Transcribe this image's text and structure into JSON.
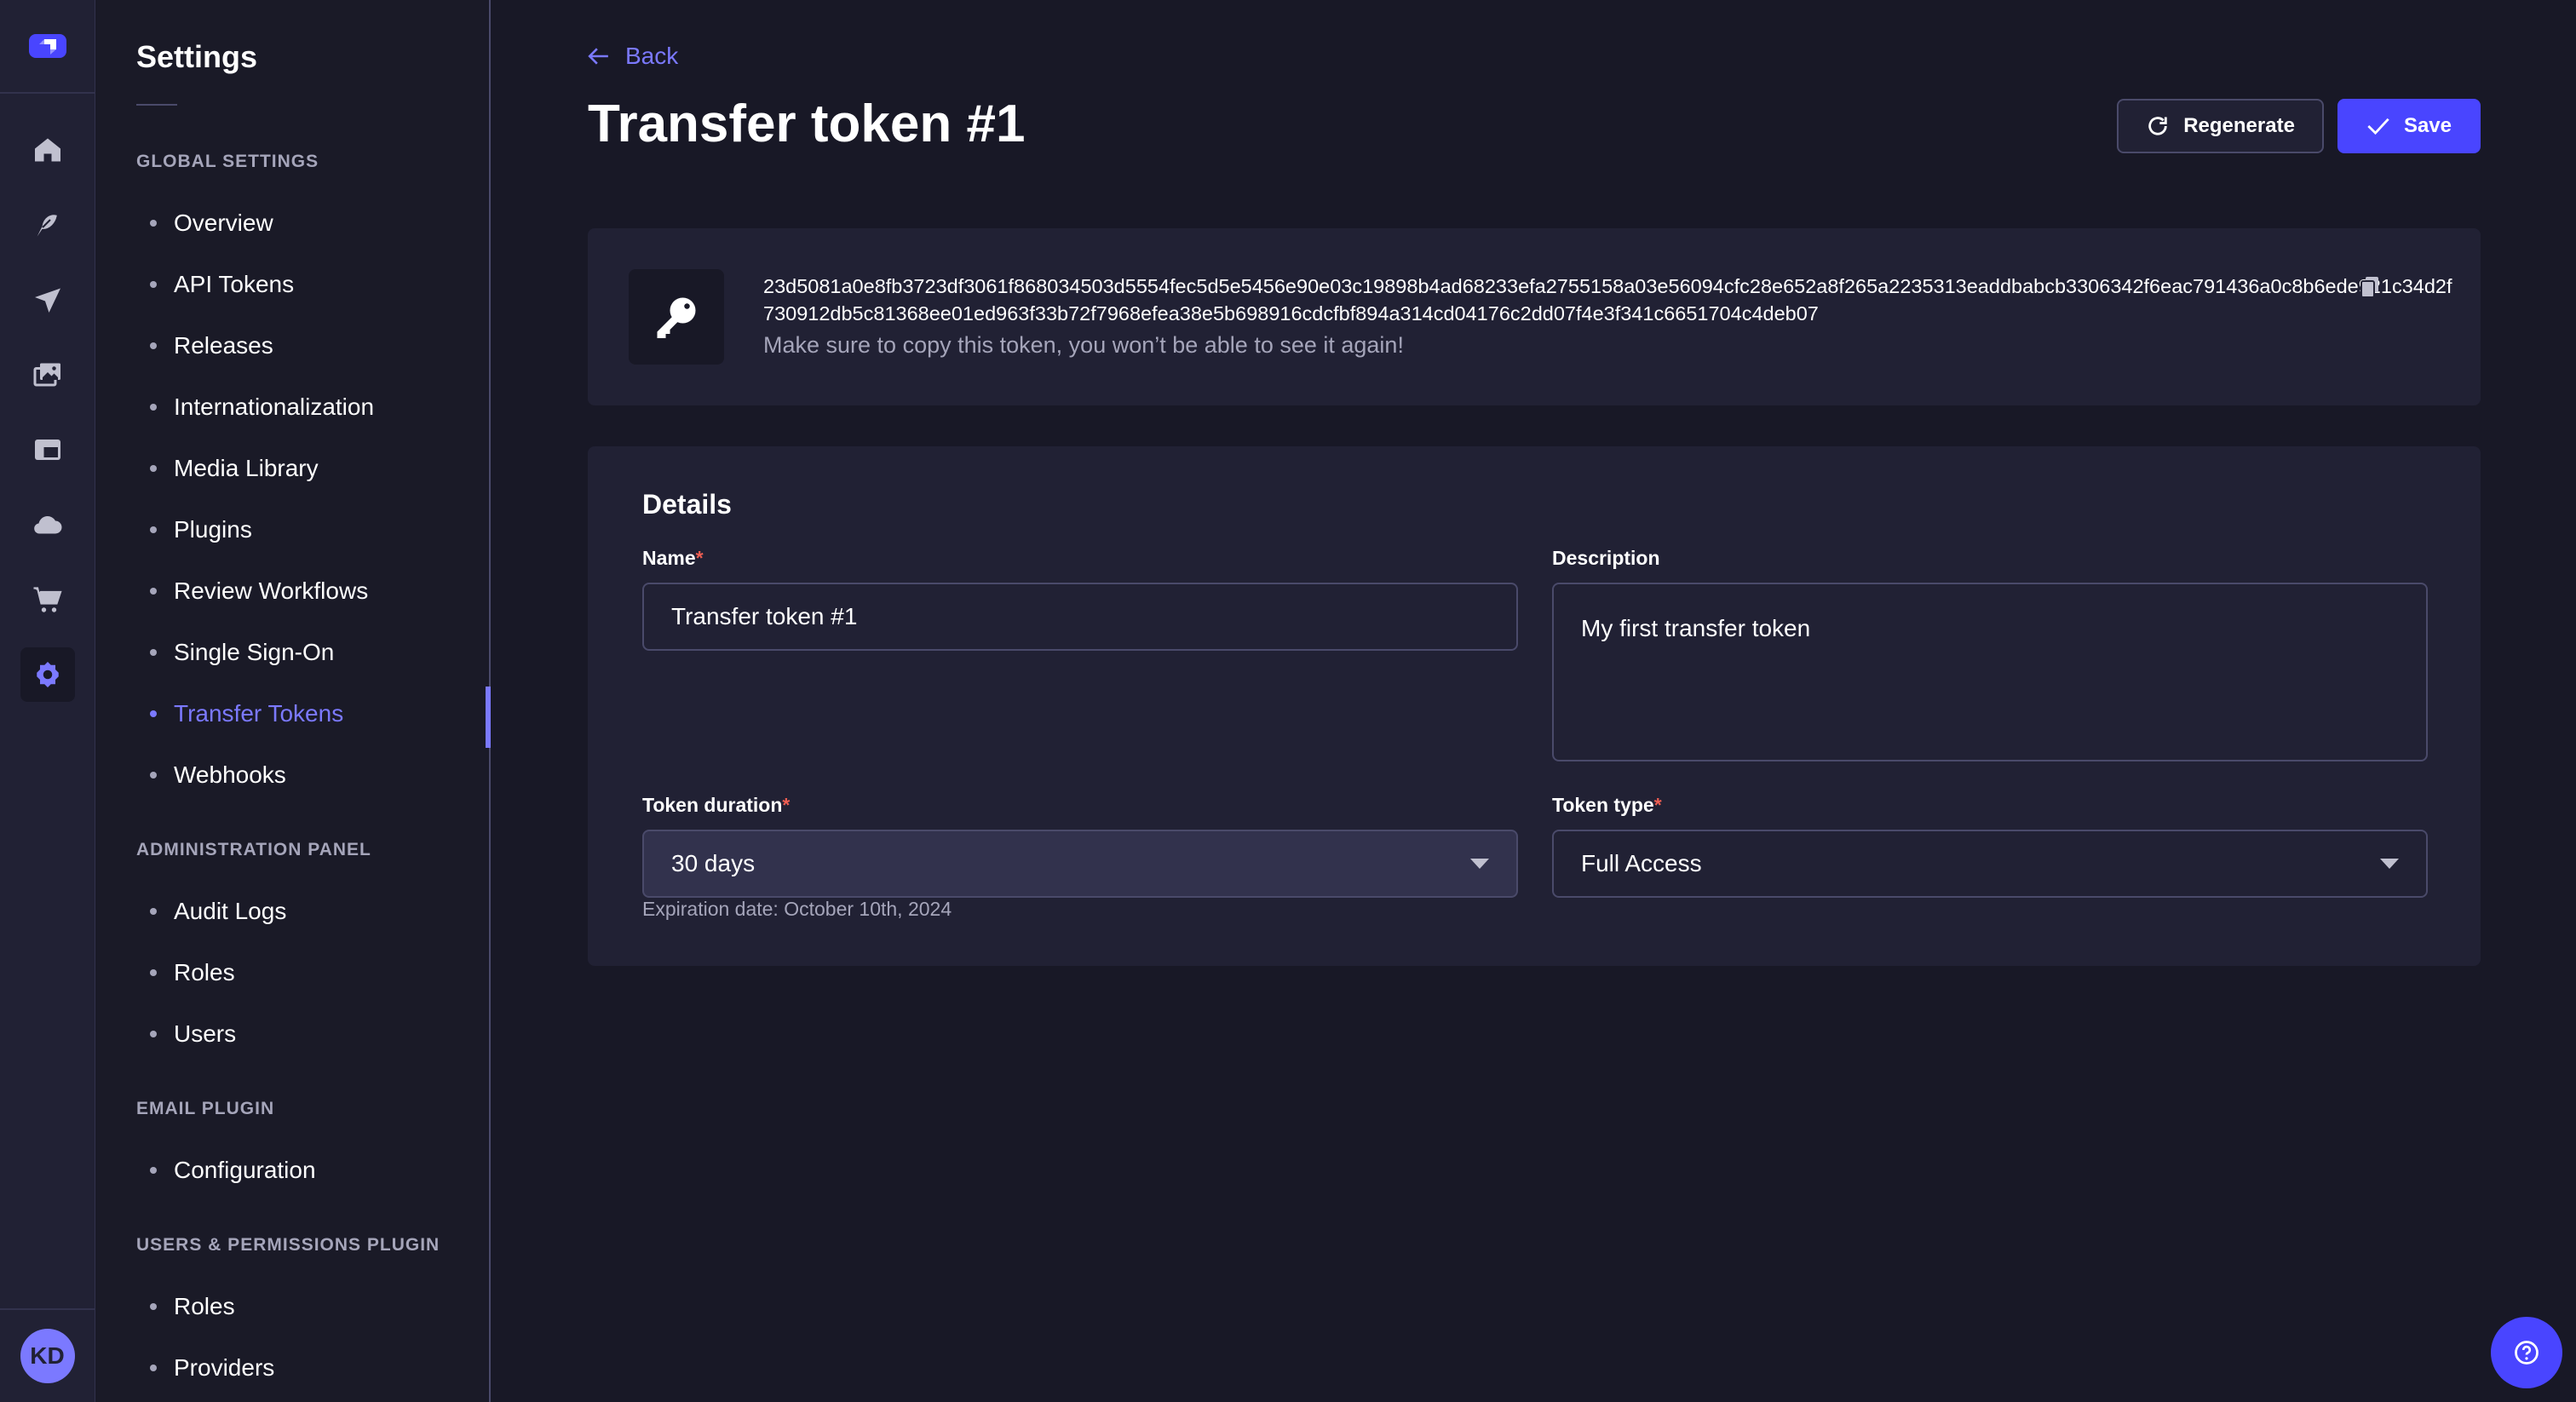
{
  "rail": {
    "logo": "strapi-logo-icon",
    "items": [
      {
        "icon": "home-icon",
        "label": "Home"
      },
      {
        "icon": "feather-icon",
        "label": "Content Manager"
      },
      {
        "icon": "paper-plane-icon",
        "label": "Releases"
      },
      {
        "icon": "images-icon",
        "label": "Media Library"
      },
      {
        "icon": "layout-icon",
        "label": "Content-Type Builder"
      },
      {
        "icon": "cloud-icon",
        "label": "Deploy"
      },
      {
        "icon": "cart-icon",
        "label": "Marketplace"
      },
      {
        "icon": "gear-icon",
        "label": "Settings",
        "active": true
      }
    ],
    "avatar_initials": "KD"
  },
  "subnav": {
    "title": "Settings",
    "sections": [
      {
        "title": "GLOBAL SETTINGS",
        "items": [
          "Overview",
          "API Tokens",
          "Releases",
          "Internationalization",
          "Media Library",
          "Plugins",
          "Review Workflows",
          "Single Sign-On",
          "Transfer Tokens",
          "Webhooks"
        ]
      },
      {
        "title": "ADMINISTRATION PANEL",
        "items": [
          "Audit Logs",
          "Roles",
          "Users"
        ]
      },
      {
        "title": "EMAIL PLUGIN",
        "items": [
          "Configuration"
        ]
      },
      {
        "title": "USERS & PERMISSIONS PLUGIN",
        "items": [
          "Roles",
          "Providers"
        ]
      }
    ],
    "active_item": "Transfer Tokens"
  },
  "header": {
    "back_label": "Back",
    "title": "Transfer token #1",
    "regenerate_label": "Regenerate",
    "save_label": "Save"
  },
  "token": {
    "value": "23d5081a0e8fb3723df3061f868034503d5554fec5d5e5456e90e03c19898b4ad68233efa2755158a03e56094cfc28e652a8f265a2235313eaddbabcb3306342f6eac791436a0c8b6ede921c34d2f730912db5c81368ee01ed963f33b72f7968efea38e5b698916cdcfbf894a314cd04176c2dd07f4e3f341c6651704c4deb07",
    "hint": "Make sure to copy this token, you won’t be able to see it again!"
  },
  "details": {
    "heading": "Details",
    "name": {
      "label": "Name",
      "required": "*",
      "value": "Transfer token #1"
    },
    "description": {
      "label": "Description",
      "value": "My first transfer token"
    },
    "duration": {
      "label": "Token duration",
      "required": "*",
      "value": "30 days",
      "hint": "Expiration date: October 10th, 2024"
    },
    "type": {
      "label": "Token type",
      "required": "*",
      "value": "Full Access"
    }
  },
  "colors": {
    "primary": "#4945ff",
    "accent": "#7b79ff",
    "danger": "#ee5e52",
    "background": "#181826",
    "surface": "#212134"
  }
}
